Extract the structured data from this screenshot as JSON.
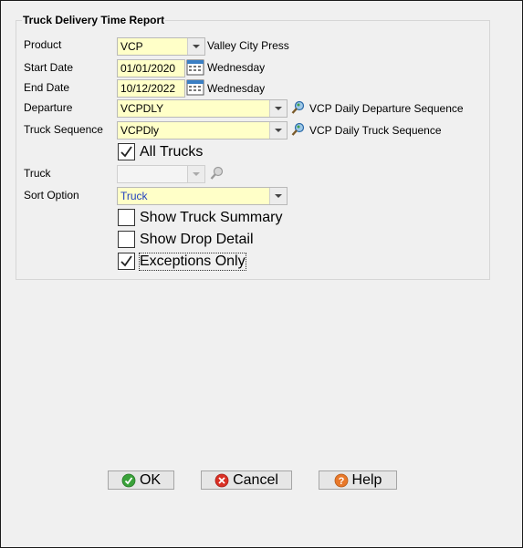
{
  "form": {
    "title": "Truck Delivery Time Report",
    "product": {
      "label": "Product",
      "value": "VCP",
      "description": "Valley City Press"
    },
    "start_date": {
      "label": "Start Date",
      "value": "01/01/2020",
      "weekday": "Wednesday"
    },
    "end_date": {
      "label": "End Date",
      "value": "10/12/2022",
      "weekday": "Wednesday"
    },
    "departure": {
      "label": "Departure",
      "value": "VCPDLY",
      "description": "VCP Daily Departure Sequence"
    },
    "truck_sequence": {
      "label": "Truck Sequence",
      "value": "VCPDly",
      "description": "VCP Daily Truck Sequence"
    },
    "all_trucks": {
      "label": "All Trucks",
      "checked": true
    },
    "truck": {
      "label": "Truck",
      "value": "",
      "enabled": false
    },
    "sort_option": {
      "label": "Sort Option",
      "value": "Truck",
      "value_color": "#1f3fbf"
    },
    "show_truck_summary": {
      "label": "Show Truck Summary",
      "checked": false
    },
    "show_drop_detail": {
      "label": "Show Drop Detail",
      "checked": false
    },
    "exceptions_only": {
      "label": "Exceptions Only",
      "checked": true
    }
  },
  "buttons": {
    "ok": "OK",
    "cancel": "Cancel",
    "help": "Help"
  },
  "colors": {
    "field_bg": "#ffffc8",
    "ok_icon": "#3aa23a",
    "cancel_icon": "#d93025",
    "help_icon": "#e8782a"
  },
  "icons": {
    "calendar": "calendar-icon",
    "lookup": "lookup-icon",
    "dropdown": "chevron-down-icon",
    "ok": "check-circle-icon",
    "cancel": "x-circle-icon",
    "help": "question-circle-icon"
  }
}
